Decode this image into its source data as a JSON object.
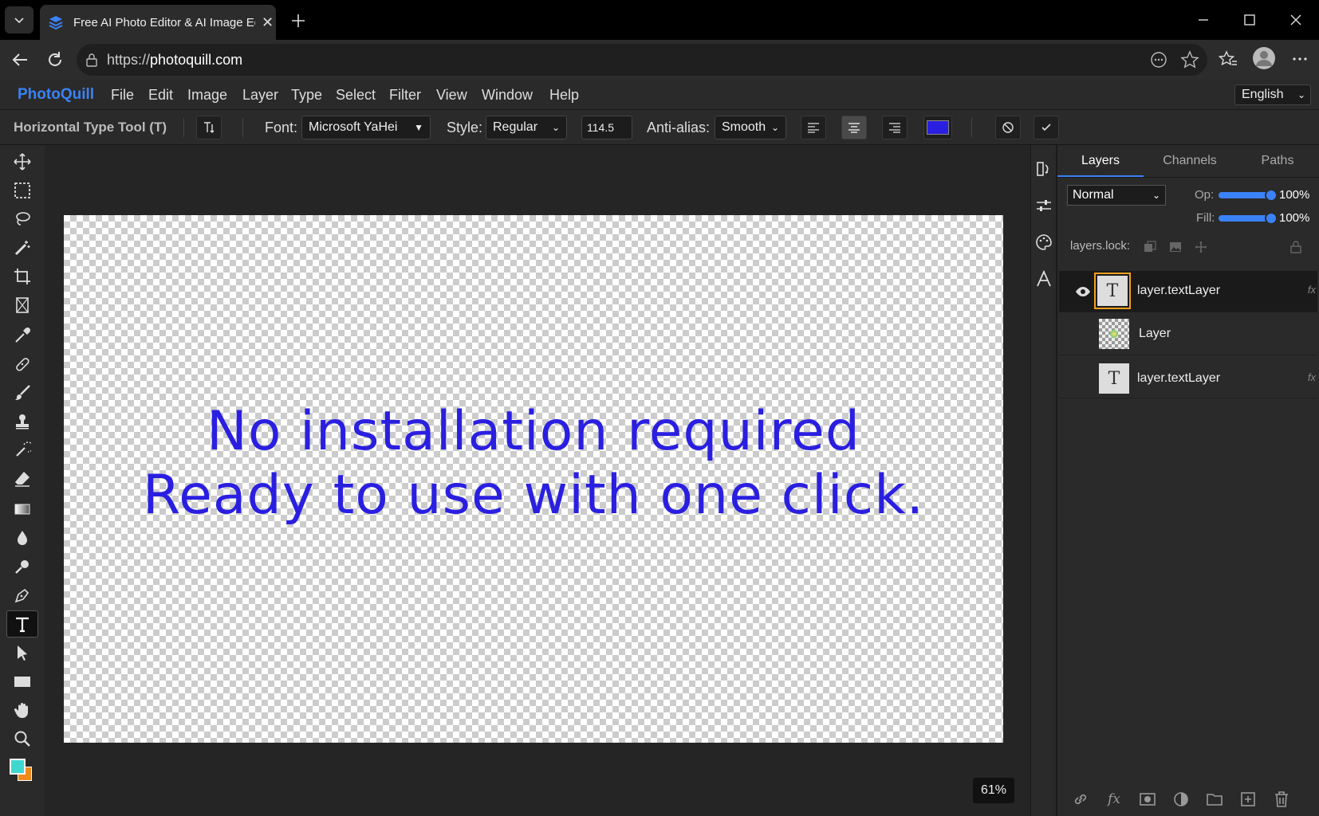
{
  "browser": {
    "tab_title": "Free AI Photo Editor & AI Image Ed",
    "url_prefix": "https://",
    "url_host": "photoquill.com"
  },
  "menubar": {
    "brand": "PhotoQuill",
    "items": [
      "File",
      "Edit",
      "Image",
      "Layer",
      "Type",
      "Select",
      "Filter",
      "View",
      "Window",
      "Help"
    ],
    "language": "English"
  },
  "options": {
    "tool_name": "Horizontal Type Tool (T)",
    "font_label": "Font:",
    "font_value": "Microsoft YaHei",
    "style_label": "Style:",
    "style_value": "Regular",
    "size_value": "114.5",
    "antialias_label": "Anti-alias:",
    "antialias_value": "Smooth",
    "text_color": "#2a1fe0"
  },
  "canvas": {
    "line1": "No installation required",
    "line2": "Ready to use with one click.",
    "zoom": "61%"
  },
  "panel": {
    "tabs": [
      "Layers",
      "Channels",
      "Paths"
    ],
    "blend_mode": "Normal",
    "opacity_label": "Op:",
    "opacity_value": "100%",
    "fill_label": "Fill:",
    "fill_value": "100%",
    "lock_label": "layers.lock:",
    "layers": [
      {
        "name": "layer.textLayer",
        "thumb": "T",
        "fx": "fx"
      },
      {
        "name": "Layer",
        "thumb": "",
        "fx": ""
      },
      {
        "name": "layer.textLayer",
        "thumb": "T",
        "fx": "fx"
      }
    ]
  },
  "colors": {
    "accent": "#3b82f6",
    "foreground_swatch": "#3fd8d0",
    "background_swatch": "#f08a1c"
  }
}
